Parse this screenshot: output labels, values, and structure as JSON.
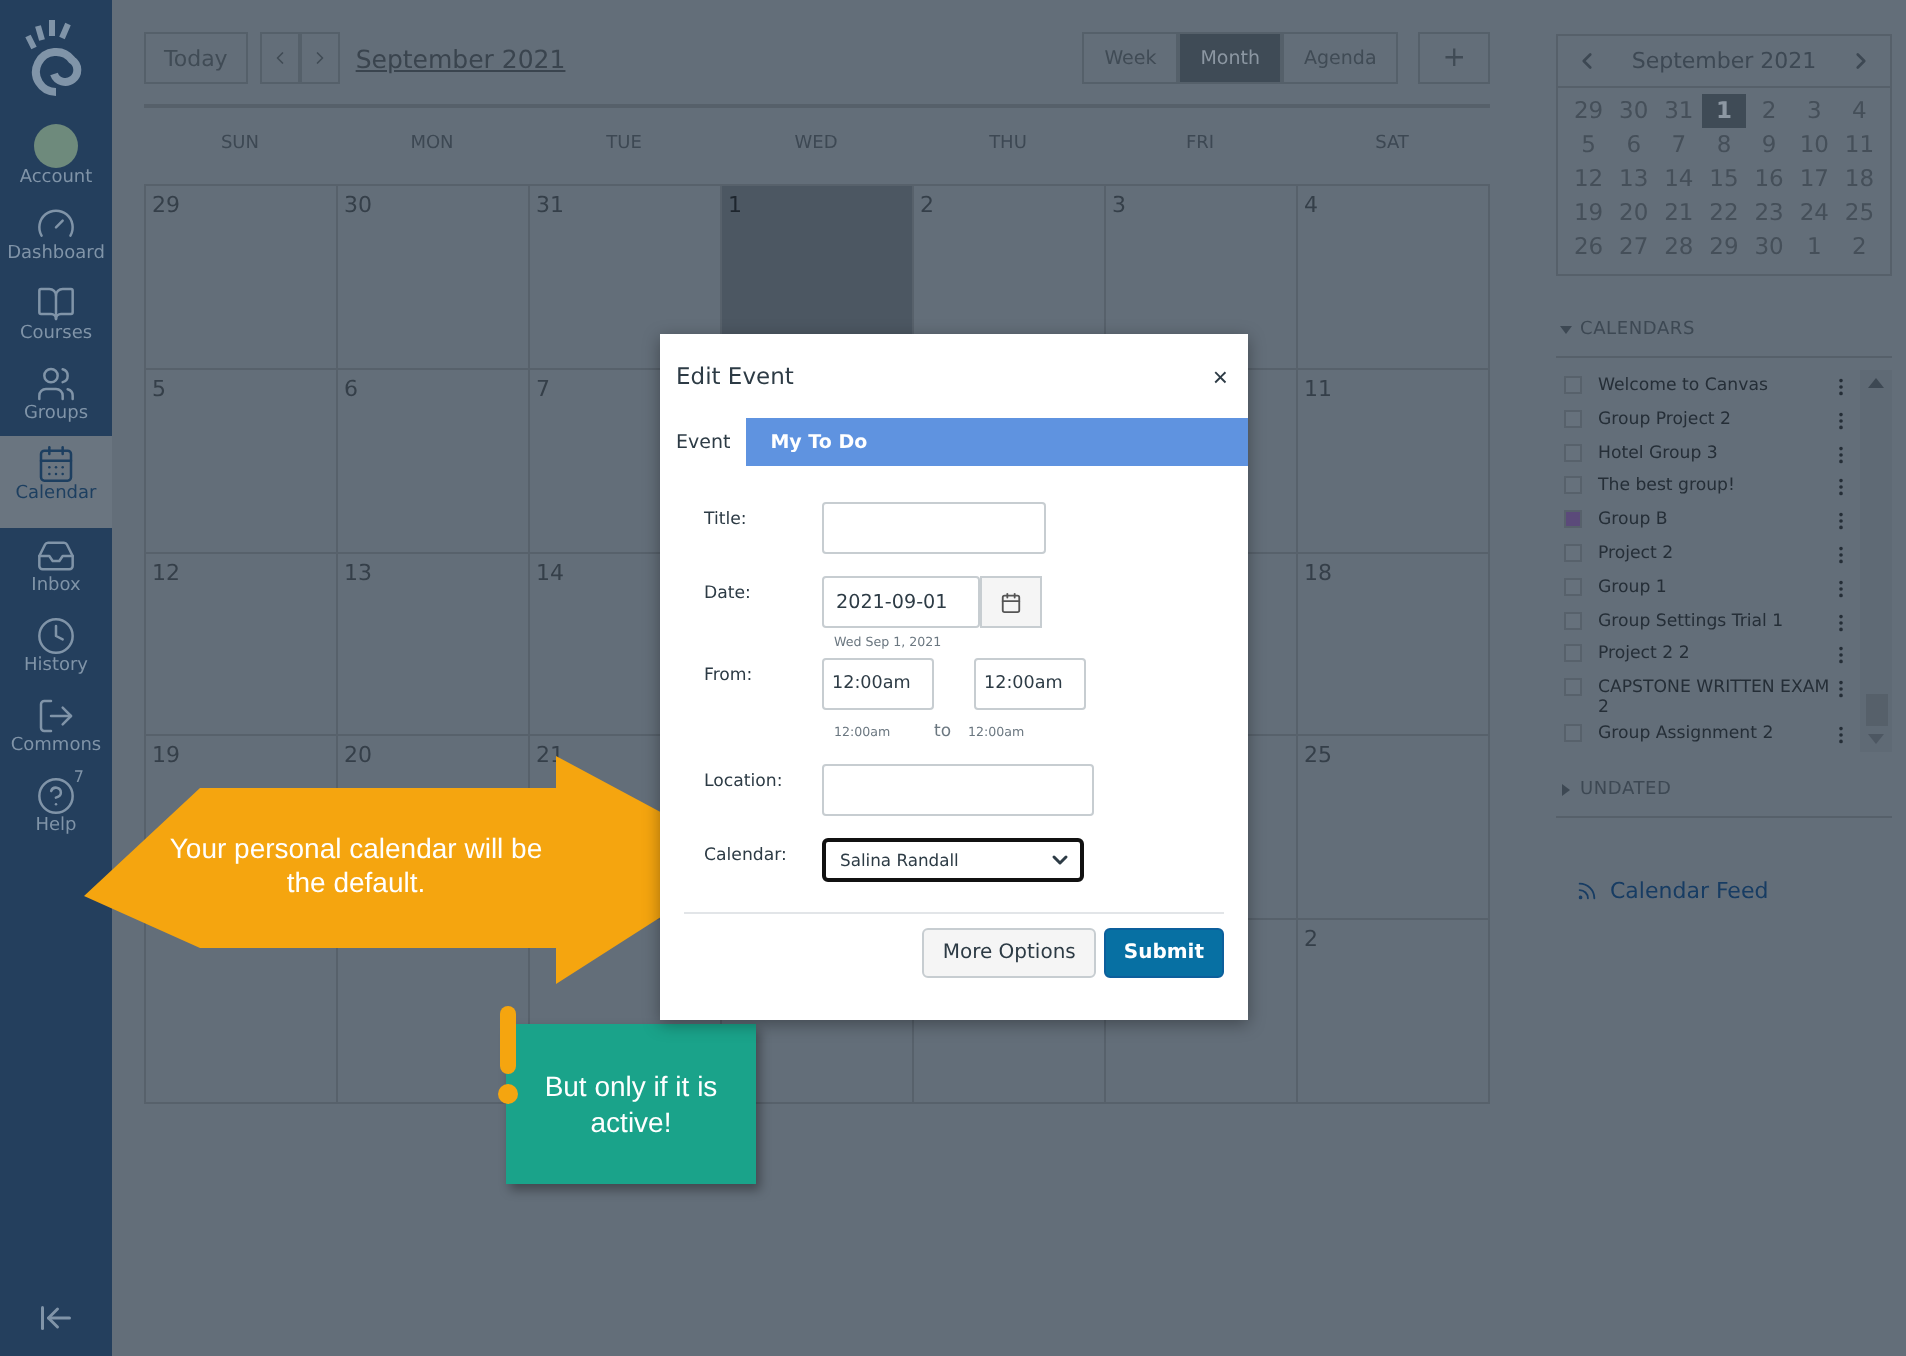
{
  "sidebar": {
    "items": [
      {
        "label": "Account",
        "selected": false
      },
      {
        "label": "Dashboard",
        "selected": false
      },
      {
        "label": "Courses",
        "selected": false
      },
      {
        "label": "Groups",
        "selected": false
      },
      {
        "label": "Calendar",
        "selected": true
      },
      {
        "label": "Inbox",
        "selected": false
      },
      {
        "label": "History",
        "selected": false
      },
      {
        "label": "Commons",
        "selected": false
      },
      {
        "label": "Help",
        "selected": false,
        "badge": "7"
      }
    ]
  },
  "toolbar": {
    "today": "Today",
    "title": "September 2021",
    "views": [
      {
        "label": "Week",
        "selected": false
      },
      {
        "label": "Month",
        "selected": true
      },
      {
        "label": "Agenda",
        "selected": false
      }
    ],
    "add": "+"
  },
  "weekdays": [
    "SUN",
    "MON",
    "TUE",
    "WED",
    "THU",
    "FRI",
    "SAT"
  ],
  "weeks": [
    {
      "left": [
        {
          "label": "29",
          "selected": false
        },
        {
          "label": "30",
          "selected": false
        },
        {
          "label": "31",
          "selected": false
        },
        {
          "label": "1",
          "selected": true
        },
        {
          "label": "2",
          "selected": false
        },
        {
          "label": "3",
          "selected": false
        },
        {
          "label": "4",
          "selected": false
        }
      ]
    },
    {
      "left": [
        {
          "label": "5",
          "selected": false
        },
        {
          "label": "6",
          "selected": false
        },
        {
          "label": "7",
          "selected": false
        }
      ],
      "right": [
        {
          "selected": false
        },
        {
          "label": "11",
          "selected": false
        }
      ]
    },
    {
      "left": [
        {
          "label": "12",
          "selected": false
        },
        {
          "label": "13",
          "selected": false
        },
        {
          "label": "14",
          "selected": false
        }
      ],
      "right": [
        {
          "selected": false
        },
        {
          "label": "18",
          "selected": false
        }
      ]
    },
    {
      "left": [
        {
          "label": "19",
          "selected": false
        },
        {
          "label": "20",
          "selected": false
        },
        {
          "label": "21",
          "selected": false
        }
      ],
      "right": [
        {
          "selected": false
        },
        {
          "label": "25",
          "selected": false
        }
      ]
    },
    {
      "left": [
        {
          "selected": false
        },
        {
          "selected": false
        },
        {
          "selected": false
        },
        {
          "selected": false
        },
        {
          "selected": false
        },
        {
          "selected": false
        },
        {
          "label": "2",
          "selected": false
        }
      ]
    }
  ],
  "dialog": {
    "title": "Edit Event",
    "close": "×",
    "tabs": [
      {
        "label": "Event",
        "selected": true
      },
      {
        "label": "My To Do",
        "selected": false
      }
    ],
    "title_label": "Title:",
    "date_label": "Date:",
    "date_value": "2021-09-01",
    "date_hint": "Wed Sep 1, 2021",
    "from_label": "From:",
    "start_value": "12:00am",
    "end_value": "12:00am",
    "start_hint": "12:00am",
    "to": "to",
    "end_hint": "12:00am",
    "location_label": "Location:",
    "calendar_label": "Calendar:",
    "calendar_value": "Salina Randall",
    "more": "More Options",
    "submit": "Submit"
  },
  "callouts": {
    "arrow": "Your personal calendar will be the default.",
    "note": "But only if it is active!"
  },
  "mini_calendar": {
    "title": "September 2021",
    "weeks": [
      [
        {
          "d": "29",
          "selected": false
        },
        {
          "d": "30",
          "selected": false
        },
        {
          "d": "31",
          "selected": false
        },
        {
          "d": "1",
          "selected": true
        },
        {
          "d": "2",
          "selected": false
        },
        {
          "d": "3",
          "selected": false
        },
        {
          "d": "4",
          "selected": false
        }
      ],
      [
        {
          "d": "5",
          "selected": false
        },
        {
          "d": "6",
          "selected": false
        },
        {
          "d": "7",
          "selected": false
        },
        {
          "d": "8",
          "selected": false
        },
        {
          "d": "9",
          "selected": false
        },
        {
          "d": "10",
          "selected": false
        },
        {
          "d": "11",
          "selected": false
        }
      ],
      [
        {
          "d": "12",
          "selected": false
        },
        {
          "d": "13",
          "selected": false
        },
        {
          "d": "14",
          "selected": false
        },
        {
          "d": "15",
          "selected": false
        },
        {
          "d": "16",
          "selected": false
        },
        {
          "d": "17",
          "selected": false
        },
        {
          "d": "18",
          "selected": false
        }
      ],
      [
        {
          "d": "19",
          "selected": false
        },
        {
          "d": "20",
          "selected": false
        },
        {
          "d": "21",
          "selected": false
        },
        {
          "d": "22",
          "selected": false
        },
        {
          "d": "23",
          "selected": false
        },
        {
          "d": "24",
          "selected": false
        },
        {
          "d": "25",
          "selected": false
        }
      ],
      [
        {
          "d": "26",
          "selected": false
        },
        {
          "d": "27",
          "selected": false
        },
        {
          "d": "28",
          "selected": false
        },
        {
          "d": "29",
          "selected": false
        },
        {
          "d": "30",
          "selected": false
        },
        {
          "d": "1",
          "selected": false
        },
        {
          "d": "2",
          "selected": false
        }
      ]
    ]
  },
  "calendars": {
    "heading": "CALENDARS",
    "items": [
      {
        "name": "Welcome to Canvas",
        "checked": false
      },
      {
        "name": "Group Project 2",
        "checked": false
      },
      {
        "name": "Hotel Group 3",
        "checked": false
      },
      {
        "name": "The best group!",
        "checked": false
      },
      {
        "name": "Group B",
        "checked": true
      },
      {
        "name": "Project 2",
        "checked": false
      },
      {
        "name": "Group 1",
        "checked": false
      },
      {
        "name": "Group Settings Trial 1",
        "checked": false
      },
      {
        "name": "Project 2 2",
        "checked": false
      },
      {
        "name": "CAPSTONE WRITTEN EXAM 2",
        "checked": false
      },
      {
        "name": "Group Assignment 2",
        "checked": false
      }
    ]
  },
  "undated": "UNDATED",
  "feed": "Calendar Feed"
}
